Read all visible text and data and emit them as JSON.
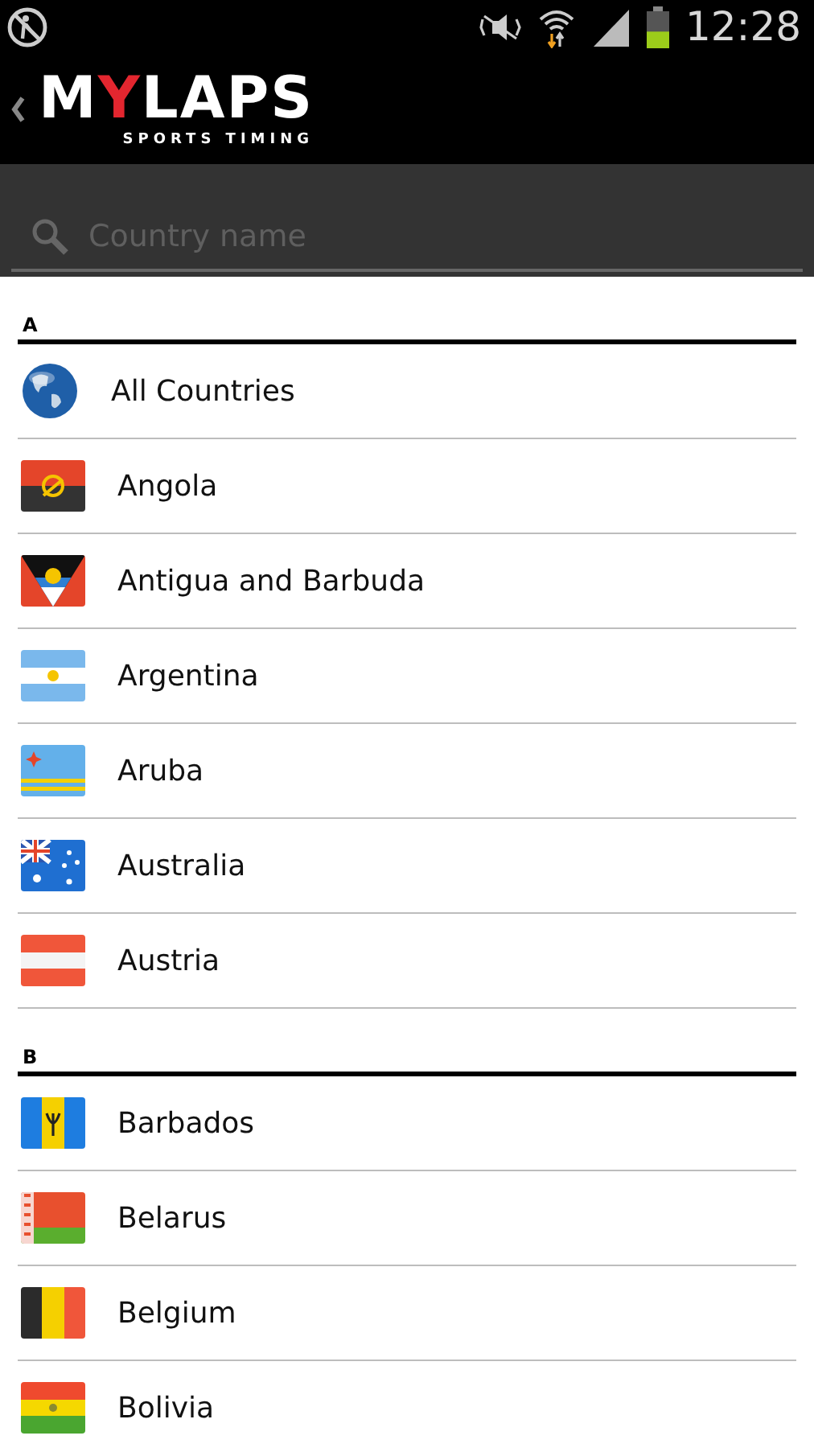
{
  "status_bar": {
    "time": "12:28"
  },
  "header": {
    "logo": [
      {
        "text": "M",
        "accent": false
      },
      {
        "text": "Y",
        "accent": true
      },
      {
        "text": "LAPS",
        "accent": false
      }
    ],
    "tagline": "SPORTS TIMING"
  },
  "search": {
    "placeholder": "Country name"
  },
  "sections": [
    {
      "letter": "A",
      "items": [
        {
          "name": "All Countries",
          "kind": "globe"
        },
        {
          "name": "Angola",
          "kind": "flag"
        },
        {
          "name": "Antigua and Barbuda",
          "kind": "flag"
        },
        {
          "name": "Argentina",
          "kind": "flag"
        },
        {
          "name": "Aruba",
          "kind": "flag"
        },
        {
          "name": "Australia",
          "kind": "flag"
        },
        {
          "name": "Austria",
          "kind": "flag"
        }
      ]
    },
    {
      "letter": "B",
      "items": [
        {
          "name": "Barbados",
          "kind": "flag"
        },
        {
          "name": "Belarus",
          "kind": "flag"
        },
        {
          "name": "Belgium",
          "kind": "flag"
        },
        {
          "name": "Bolivia",
          "kind": "flag"
        }
      ]
    }
  ]
}
